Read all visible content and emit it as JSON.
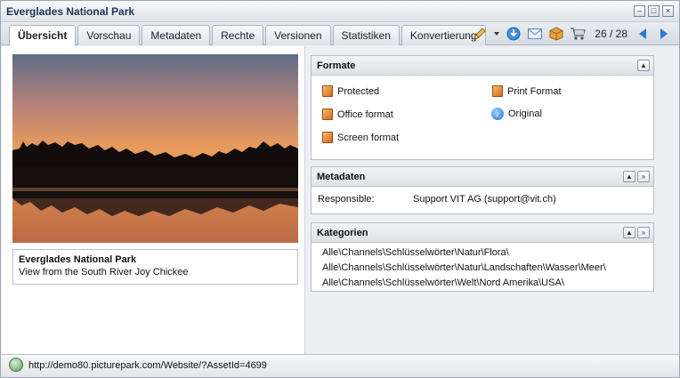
{
  "window": {
    "title": "Everglades National Park"
  },
  "tabs": [
    {
      "label": "Übersicht",
      "active": true
    },
    {
      "label": "Vorschau",
      "active": false
    },
    {
      "label": "Metadaten",
      "active": false
    },
    {
      "label": "Rechte",
      "active": false
    },
    {
      "label": "Versionen",
      "active": false
    },
    {
      "label": "Statistiken",
      "active": false
    },
    {
      "label": "Konvertierung",
      "active": false
    }
  ],
  "toolbar": {
    "icons": [
      "pencil-icon",
      "chevron-down-icon",
      "download-icon",
      "mail-icon",
      "package-icon",
      "cart-icon"
    ],
    "pager": "26 / 28"
  },
  "preview": {
    "caption_title": "Everglades National Park",
    "caption_text": "View from the South River Joy Chickee"
  },
  "formats": {
    "title": "Formate",
    "items": [
      {
        "label": "Protected",
        "icon": "document-icon"
      },
      {
        "label": "Print Format",
        "icon": "document-icon"
      },
      {
        "label": "Office format",
        "icon": "document-icon"
      },
      {
        "label": "Original",
        "icon": "download-icon"
      },
      {
        "label": "Screen format",
        "icon": "document-icon"
      }
    ]
  },
  "metadata": {
    "title": "Metadaten",
    "label": "Responsible:",
    "value": "Support VIT AG (support@vit.ch)"
  },
  "categories": {
    "title": "Kategorien",
    "items": [
      "Alle\\Channels\\Schlüsselwörter\\Natur\\Flora\\",
      "Alle\\Channels\\Schlüsselwörter\\Natur\\Landschaften\\Wasser\\Meer\\",
      "Alle\\Channels\\Schlüsselwörter\\Welt\\Nord Amerika\\USA\\"
    ]
  },
  "status": {
    "url": "http://demo80.picturepark.com/Website/?AssetId=4699"
  },
  "colors": {
    "accent": "#2b7bd6",
    "title": "#1d3557"
  }
}
